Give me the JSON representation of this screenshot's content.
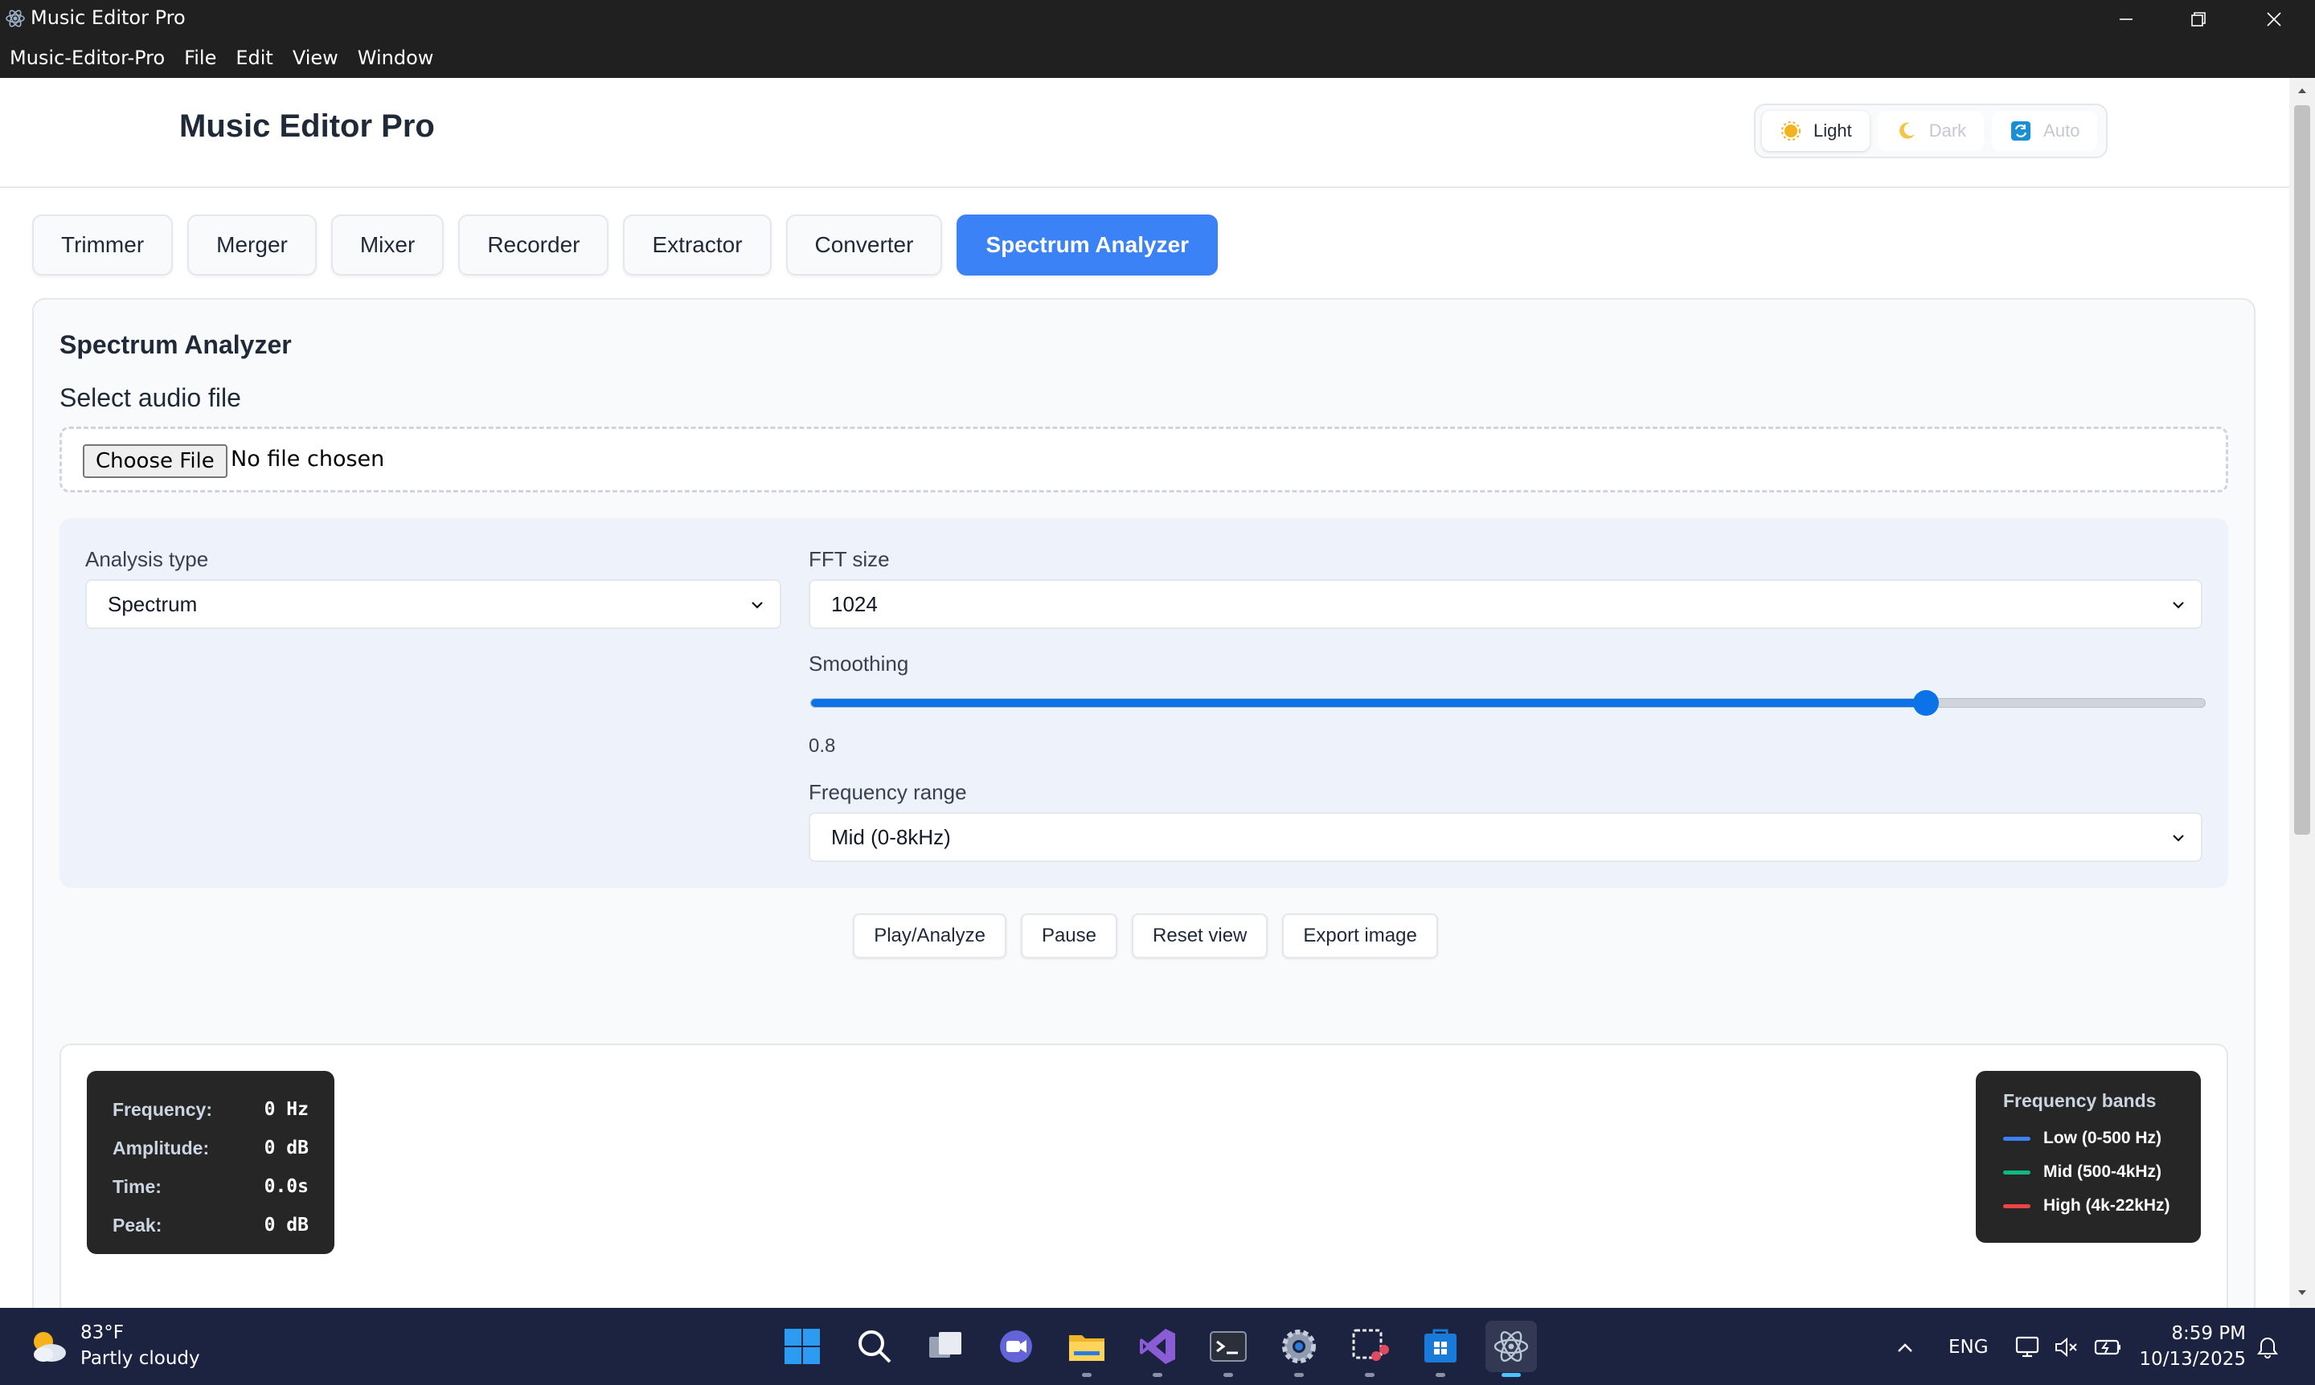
{
  "window": {
    "title": "Music Editor Pro"
  },
  "menubar": {
    "items": [
      "Music-Editor-Pro",
      "File",
      "Edit",
      "View",
      "Window"
    ]
  },
  "header": {
    "app_title": "Music Editor Pro",
    "theme": {
      "options": [
        "Light",
        "Dark",
        "Auto"
      ],
      "selected": "Light"
    }
  },
  "tabs": {
    "items": [
      "Trimmer",
      "Merger",
      "Mixer",
      "Recorder",
      "Extractor",
      "Converter",
      "Spectrum Analyzer"
    ],
    "active": "Spectrum Analyzer"
  },
  "panel": {
    "title": "Spectrum Analyzer",
    "select_label": "Select audio file",
    "file_button": "Choose File",
    "file_status": "No file chosen",
    "analysis_type": {
      "label": "Analysis type",
      "value": "Spectrum"
    },
    "fft_size": {
      "label": "FFT size",
      "value": "1024"
    },
    "smoothing": {
      "label": "Smoothing",
      "value": "0.8",
      "fraction": 0.8
    },
    "frequency_range": {
      "label": "Frequency range",
      "value": "Mid (0-8kHz)"
    },
    "actions": [
      "Play/Analyze",
      "Pause",
      "Reset view",
      "Export image"
    ]
  },
  "readout": {
    "rows": [
      {
        "key": "Frequency:",
        "value": "0 Hz"
      },
      {
        "key": "Amplitude:",
        "value": "0 dB"
      },
      {
        "key": "Time:",
        "value": "0.0s"
      },
      {
        "key": "Peak:",
        "value": "0 dB"
      }
    ]
  },
  "legend": {
    "title": "Frequency bands",
    "items": [
      {
        "label": "Low (0-500 Hz)",
        "color": "#3b82f6"
      },
      {
        "label": "Mid (500-4kHz)",
        "color": "#10b981"
      },
      {
        "label": "High (4k-22kHz)",
        "color": "#ef4444"
      }
    ]
  },
  "colors": {
    "accent": "#3b82f6",
    "slider": "#0b72e7"
  },
  "taskbar": {
    "weather": {
      "temp": "83°F",
      "condition": "Partly cloudy"
    },
    "apps": [
      "start-icon",
      "search-icon",
      "task-view-icon",
      "meet-icon",
      "file-explorer-icon",
      "visual-studio-icon",
      "terminal-icon",
      "settings-icon",
      "snipping-tool-icon",
      "store-icon",
      "electron-app-icon"
    ],
    "language": "ENG",
    "time": "8:59 PM",
    "date": "10/13/2025"
  }
}
